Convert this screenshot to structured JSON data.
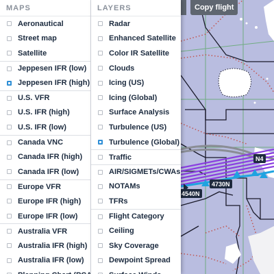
{
  "maps": {
    "header": "MAPS",
    "items": [
      {
        "label": "Aeronautical",
        "checked": false,
        "sep": false
      },
      {
        "label": "Street map",
        "checked": false,
        "sep": false
      },
      {
        "label": "Satellite",
        "checked": false,
        "sep": false
      },
      {
        "label": "Jeppesen IFR (low)",
        "checked": false,
        "sep": true
      },
      {
        "label": "Jeppesen IFR (high)",
        "checked": true,
        "sep": false
      },
      {
        "label": "U.S. VFR",
        "checked": false,
        "sep": true
      },
      {
        "label": "U.S. IFR (high)",
        "checked": false,
        "sep": false
      },
      {
        "label": "U.S. IFR (low)",
        "checked": false,
        "sep": false
      },
      {
        "label": "Canada VNC",
        "checked": false,
        "sep": true
      },
      {
        "label": "Canada IFR (high)",
        "checked": false,
        "sep": false
      },
      {
        "label": "Canada IFR (low)",
        "checked": false,
        "sep": false
      },
      {
        "label": "Europe VFR",
        "checked": false,
        "sep": true
      },
      {
        "label": "Europe IFR (high)",
        "checked": false,
        "sep": false
      },
      {
        "label": "Europe IFR (low)",
        "checked": false,
        "sep": false
      },
      {
        "label": "Australia VFR",
        "checked": false,
        "sep": true
      },
      {
        "label": "Australia IFR (high)",
        "checked": false,
        "sep": false
      },
      {
        "label": "Australia IFR (low)",
        "checked": false,
        "sep": false
      },
      {
        "label": "Planning Chart (PCA)",
        "checked": false,
        "sep": false
      }
    ]
  },
  "layers": {
    "header": "LAYERS",
    "items": [
      {
        "label": "Radar",
        "checked": false,
        "sep": false
      },
      {
        "label": "Enhanced Satellite",
        "checked": false,
        "sep": false
      },
      {
        "label": "Color IR Satellite",
        "checked": false,
        "sep": false
      },
      {
        "label": "Clouds",
        "checked": false,
        "sep": false
      },
      {
        "label": "Icing (US)",
        "checked": false,
        "sep": false
      },
      {
        "label": "Icing (Global)",
        "checked": false,
        "sep": false
      },
      {
        "label": "Surface Analysis",
        "checked": false,
        "sep": false
      },
      {
        "label": "Turbulence (US)",
        "checked": false,
        "sep": false
      },
      {
        "label": "Turbulence (Global)",
        "checked": true,
        "sep": false
      },
      {
        "label": "Traffic",
        "checked": false,
        "sep": true
      },
      {
        "label": "AIR/SIGMETs/CWAs",
        "checked": false,
        "sep": true
      },
      {
        "label": "NOTAMs",
        "checked": false,
        "sep": false
      },
      {
        "label": "TFRs",
        "checked": false,
        "sep": false
      },
      {
        "label": "Flight Category",
        "checked": false,
        "sep": true
      },
      {
        "label": "Ceiling",
        "checked": false,
        "sep": false
      },
      {
        "label": "Sky Coverage",
        "checked": false,
        "sep": false
      },
      {
        "label": "Dewpoint Spread",
        "checked": false,
        "sep": false
      },
      {
        "label": "Surface Winds",
        "checked": false,
        "sep": false
      }
    ]
  },
  "toolbar": {
    "copy_flight_label": "Copy flight"
  },
  "map": {
    "route_labels": [
      "N4",
      "4730N",
      "4540N"
    ]
  },
  "colors": {
    "map_bg": "#b9bde0",
    "turbulence_purple": "#8a3fe0",
    "route_cyan": "#1fa3e0",
    "check_blue": "#2f8fd6"
  }
}
